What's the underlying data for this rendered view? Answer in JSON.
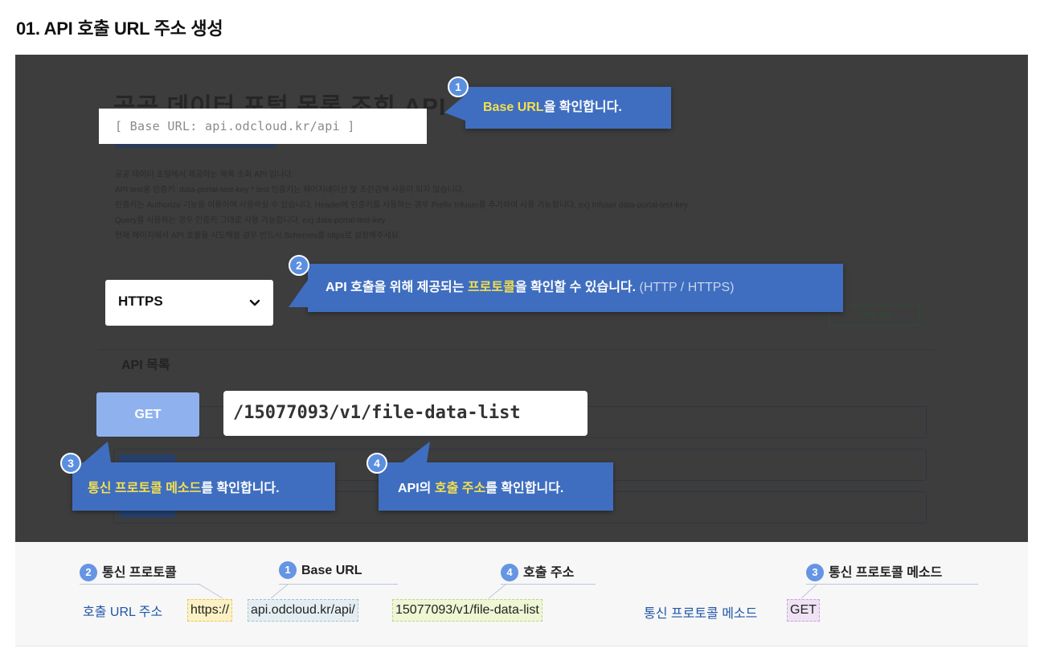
{
  "page": {
    "title": "01. API 호출 URL 주소 생성"
  },
  "screenshot": {
    "ghost_title": "공공 데이터 포털 목록 조회 API",
    "ghost_description": [
      "공공 데이터 포털에서 제공하는 목록 조회 API 입니다.",
      "API test용 인증키: data-portal-test-key * test 인증키는 페이지네이션 및 조건검색 사용이 되지 않습니다.",
      "인증키는 Authorize 기능을 이용하여 사용하실 수 있습니다. Header에 인증키를 사용하는 경우 Prefix Infuser를 추가하여 사용 가능합니다. ex) Infuser data-portal-test-key",
      "Query를 사용하는 경우 인증키 그대로 사용 가능합니다. ex) data-portal-test-key",
      "현재 페이지에서 API 호출을 시도해볼 경우 반드시 Schemes를 https로 설정해주세요."
    ],
    "auth_button": "인증키 설정",
    "api_list_heading": "API 목록",
    "base_url_box": "[ Base URL: api.odcloud.kr/api ]",
    "scheme_select": {
      "value": "HTTPS"
    },
    "method_button": "GET",
    "endpoint": "/15077093/v1/file-data-list"
  },
  "callouts": {
    "c1": {
      "number": "1",
      "pre": "",
      "highlight": "Base URL",
      "post": "을 확인합니다.",
      "muted": ""
    },
    "c2": {
      "number": "2",
      "pre": "API 호출을 위해 제공되는 ",
      "highlight": "프로토콜",
      "post": "을 확인할 수 있습니다.",
      "muted": " (HTTP / HTTPS)"
    },
    "c3": {
      "number": "3",
      "pre": "",
      "highlight": "통신 프로토콜 메소드",
      "post": "를 확인합니다.",
      "muted": ""
    },
    "c4": {
      "number": "4",
      "pre": "API의 ",
      "highlight": "호출 주소",
      "post": "를 확인합니다.",
      "muted": ""
    }
  },
  "legend": {
    "protocol": {
      "number": "2",
      "label": "통신 프로토콜"
    },
    "base_url": {
      "number": "1",
      "label": "Base URL"
    },
    "call_address": {
      "number": "4",
      "label": "호출 주소"
    },
    "method": {
      "number": "3",
      "label": "통신 프로토콜 메소드"
    }
  },
  "url_row": {
    "label": "호출 URL 주소",
    "protocol_part": "https://",
    "base_part": "api.odcloud.kr/api/",
    "path_part": "15077093/v1/file-data-list",
    "method_label": "통신 프로토콜 메소드",
    "method_value": "GET"
  },
  "colors": {
    "callout_bg": "#3f6ec0",
    "highlight_text": "#f4df4e",
    "panel_bg": "#3d3d3d",
    "method_button": "#8fb2ef",
    "link_blue": "#1f56a8"
  }
}
